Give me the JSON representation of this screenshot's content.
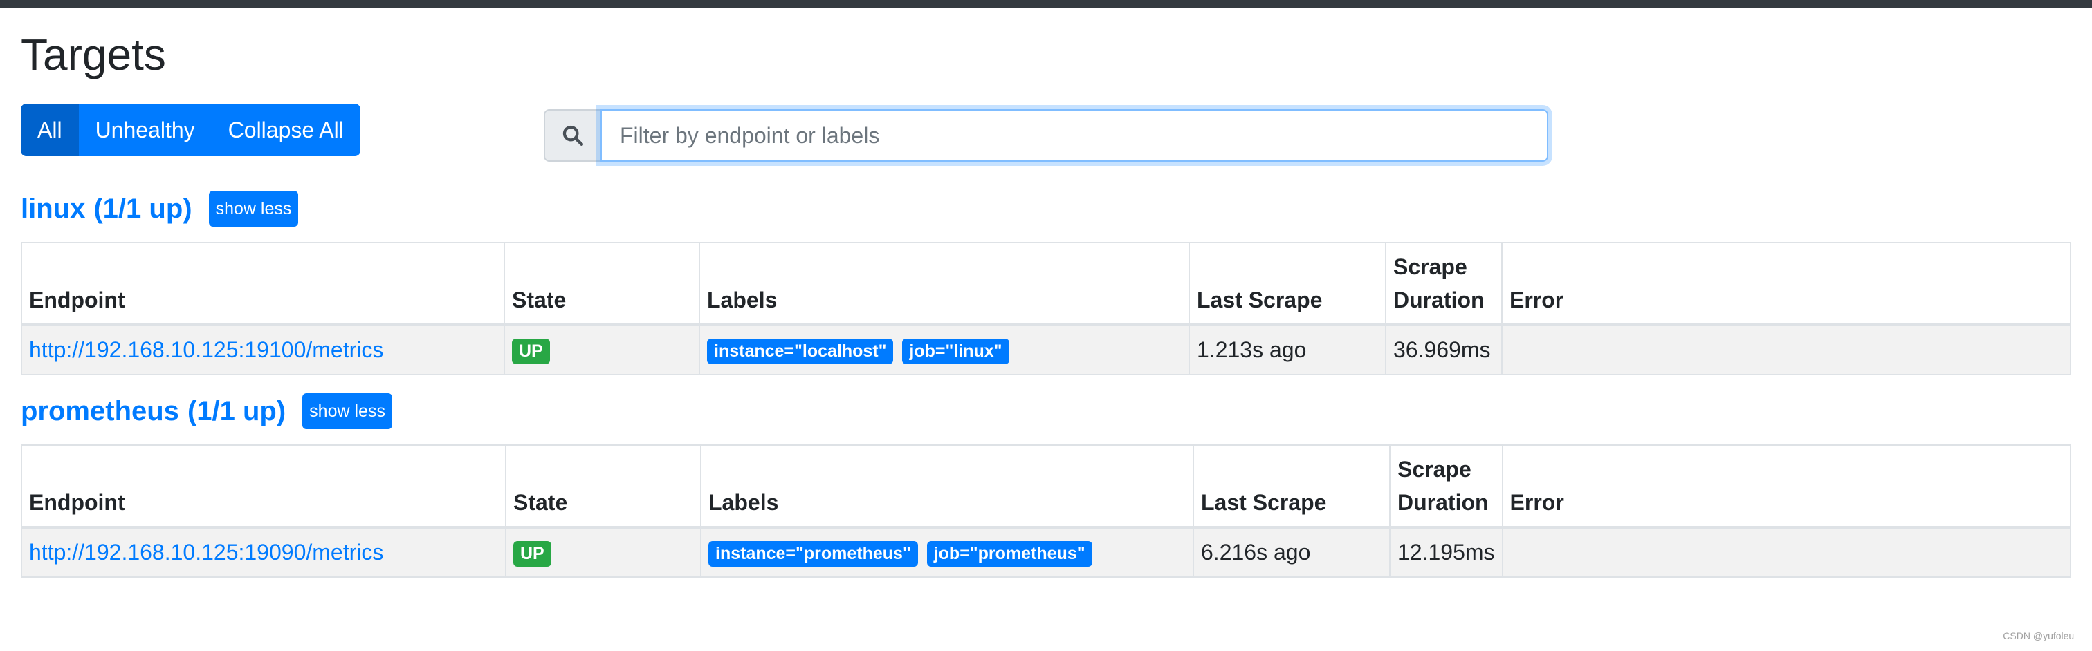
{
  "page": {
    "title": "Targets"
  },
  "filters": {
    "all_label": "All",
    "unhealthy_label": "Unhealthy",
    "collapse_label": "Collapse All"
  },
  "search": {
    "placeholder": "Filter by endpoint or labels",
    "value": ""
  },
  "columns": {
    "endpoint": "Endpoint",
    "state": "State",
    "labels": "Labels",
    "last_scrape": "Last Scrape",
    "scrape_duration_1": "Scrape",
    "scrape_duration_2": "Duration",
    "error": "Error"
  },
  "jobs": [
    {
      "name": "linux",
      "count": "(1/1 up)",
      "toggle_label": "show less",
      "targets": [
        {
          "endpoint": "http://192.168.10.125:19100/metrics",
          "state": "UP",
          "labels": [
            "instance=\"localhost\"",
            "job=\"linux\""
          ],
          "last_scrape": "1.213s ago",
          "scrape_duration": "36.969ms",
          "error": ""
        }
      ]
    },
    {
      "name": "prometheus",
      "count": "(1/1 up)",
      "toggle_label": "show less",
      "targets": [
        {
          "endpoint": "http://192.168.10.125:19090/metrics",
          "state": "UP",
          "labels": [
            "instance=\"prometheus\"",
            "job=\"prometheus\""
          ],
          "last_scrape": "6.216s ago",
          "scrape_duration": "12.195ms",
          "error": ""
        }
      ]
    }
  ],
  "watermark": "CSDN @yufoleu_",
  "colors": {
    "primary": "#007bff",
    "success": "#28a745",
    "topbar": "#343a40"
  },
  "icons": {
    "search": "search-icon"
  }
}
